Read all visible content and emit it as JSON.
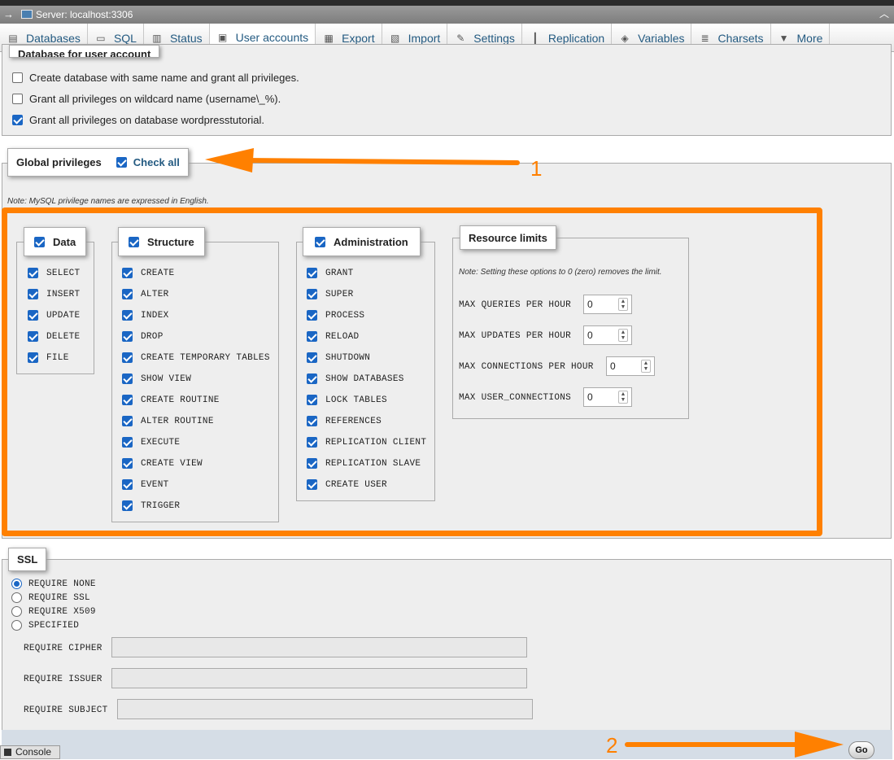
{
  "server_bar": {
    "title": "Server: localhost:3306"
  },
  "tabs": [
    {
      "label": "Databases",
      "icon": "databases-icon"
    },
    {
      "label": "SQL",
      "icon": "sql-icon"
    },
    {
      "label": "Status",
      "icon": "status-icon"
    },
    {
      "label": "User accounts",
      "icon": "user-accounts-icon",
      "active": true
    },
    {
      "label": "Export",
      "icon": "export-icon"
    },
    {
      "label": "Import",
      "icon": "import-icon"
    },
    {
      "label": "Settings",
      "icon": "settings-icon"
    },
    {
      "label": "Replication",
      "icon": "replication-icon"
    },
    {
      "label": "Variables",
      "icon": "variables-icon"
    },
    {
      "label": "Charsets",
      "icon": "charsets-icon"
    },
    {
      "label": "More",
      "icon": "chevron-down-icon"
    }
  ],
  "database_section": {
    "legend": "Database for user account",
    "options": [
      {
        "label": "Create database with same name and grant all privileges.",
        "checked": false
      },
      {
        "label": "Grant all privileges on wildcard name (username\\_%).",
        "checked": false
      },
      {
        "label": "Grant all privileges on database wordpresstutorial.",
        "checked": true
      }
    ]
  },
  "global_privileges": {
    "legend": "Global privileges",
    "check_all_label": "Check all",
    "check_all_checked": true,
    "note": "Note: MySQL privilege names are expressed in English.",
    "data": {
      "legend": "Data",
      "items": [
        "SELECT",
        "INSERT",
        "UPDATE",
        "DELETE",
        "FILE"
      ]
    },
    "structure": {
      "legend": "Structure",
      "items": [
        "CREATE",
        "ALTER",
        "INDEX",
        "DROP",
        "CREATE TEMPORARY TABLES",
        "SHOW VIEW",
        "CREATE ROUTINE",
        "ALTER ROUTINE",
        "EXECUTE",
        "CREATE VIEW",
        "EVENT",
        "TRIGGER"
      ]
    },
    "administration": {
      "legend": "Administration",
      "items": [
        "GRANT",
        "SUPER",
        "PROCESS",
        "RELOAD",
        "SHUTDOWN",
        "SHOW DATABASES",
        "LOCK TABLES",
        "REFERENCES",
        "REPLICATION CLIENT",
        "REPLICATION SLAVE",
        "CREATE USER"
      ]
    },
    "resource_limits": {
      "legend": "Resource limits",
      "note": "Note: Setting these options to 0 (zero) removes the limit.",
      "fields": [
        {
          "label": "MAX QUERIES PER HOUR",
          "value": "0"
        },
        {
          "label": "MAX UPDATES PER HOUR",
          "value": "0"
        },
        {
          "label": "MAX CONNECTIONS PER HOUR",
          "value": "0"
        },
        {
          "label": "MAX USER_CONNECTIONS",
          "value": "0"
        }
      ]
    }
  },
  "ssl": {
    "legend": "SSL",
    "options": [
      {
        "label": "REQUIRE NONE",
        "selected": true
      },
      {
        "label": "REQUIRE SSL",
        "selected": false
      },
      {
        "label": "REQUIRE X509",
        "selected": false
      },
      {
        "label": "SPECIFIED",
        "selected": false
      }
    ],
    "fields": [
      {
        "label": "REQUIRE CIPHER",
        "value": ""
      },
      {
        "label": "REQUIRE ISSUER",
        "value": ""
      },
      {
        "label": "REQUIRE SUBJECT",
        "value": ""
      }
    ]
  },
  "annotations": {
    "step1": "1",
    "step2": "2",
    "highlight_color": "#ff8000"
  },
  "footer": {
    "go_label": "Go"
  },
  "console": {
    "label": "Console"
  }
}
